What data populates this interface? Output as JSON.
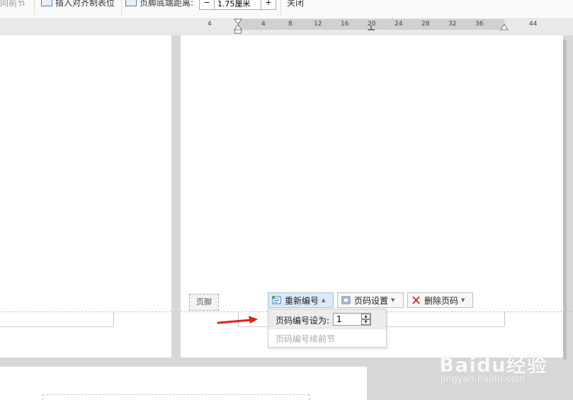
{
  "toolbar": {
    "prev_section": "同前节",
    "insert_tab_stop": "插入对齐制表位",
    "footer_bottom_distance_label": "页脚底端距离:",
    "minus": "−",
    "distance_value": "1.75厘米",
    "plus": "+",
    "close": "关闭"
  },
  "ruler": {
    "ticks": [
      "4",
      "4",
      "8",
      "12",
      "16",
      "20",
      "24",
      "28",
      "32",
      "36",
      "44"
    ]
  },
  "footer": {
    "tag": "页脚",
    "renumber_button": "重新编号",
    "page_setup_button": "页码设置",
    "delete_page_button": "删除页码"
  },
  "renumber_dropdown": {
    "set_label": "页码编号设为:",
    "value": "1",
    "continue_label": "页码编号续前节"
  },
  "watermark": {
    "brand": "Baidu经验",
    "url": "jingyan.baidu.com"
  },
  "colors": {
    "arrow": "#e02020",
    "active_button": "#dbe8f7",
    "delete_icon": "#e03030"
  }
}
